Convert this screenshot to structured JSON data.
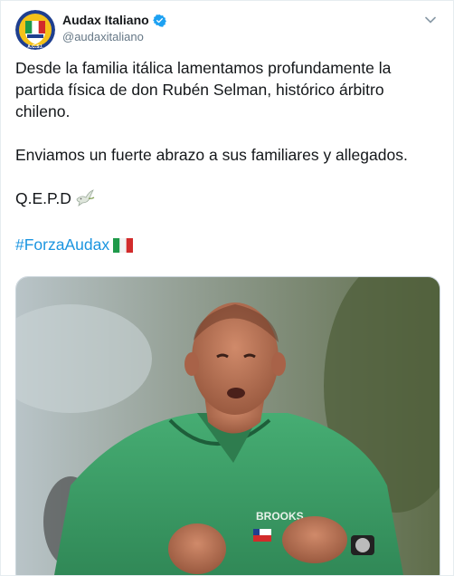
{
  "tweet": {
    "display_name": "Audax Italiano",
    "handle": "@audaxitaliano",
    "verified": true,
    "paragraphs": {
      "p1": "Desde la familia itálica lamentamos profundamente la partida física de don Rubén Selman, histórico árbitro chileno.",
      "p2": "Enviamos un fuerte abrazo a sus familiares y allegados.",
      "p3": "Q.E.P.D",
      "p4": "#ForzaAudax"
    },
    "icons": {
      "avatar": "audax-italiano-crest",
      "verified": "verified-badge-icon",
      "menu": "chevron-down-icon",
      "emoji_1": "dove-icon",
      "emoji_2": "italy-flag-icon"
    },
    "media": {
      "description_icon": "referee-photo",
      "shirt_brand": "BROOKS"
    }
  },
  "colors": {
    "link": "#1b95e0",
    "secondary_text": "#657786",
    "verified": "#1da1f2",
    "shirt_green": "#3fa36a"
  }
}
